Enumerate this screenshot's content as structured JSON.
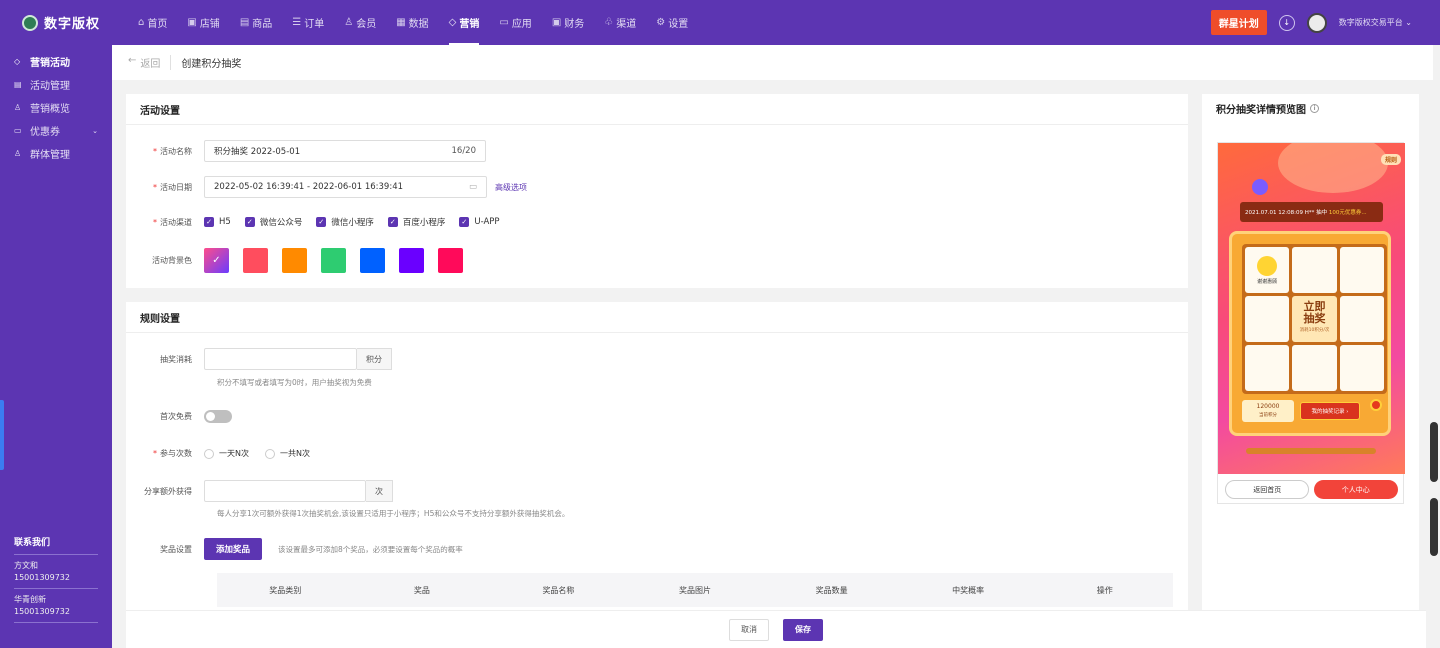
{
  "app": {
    "logo_text": "数字版权"
  },
  "nav": [
    {
      "label": "首页",
      "icon": "home-icon",
      "glyph": "⌂",
      "active": false
    },
    {
      "label": "店铺",
      "icon": "store-icon",
      "glyph": "▣",
      "active": false
    },
    {
      "label": "商品",
      "icon": "goods-icon",
      "glyph": "▤",
      "active": false
    },
    {
      "label": "订单",
      "icon": "order-icon",
      "glyph": "☰",
      "active": false
    },
    {
      "label": "会员",
      "icon": "member-icon",
      "glyph": "♙",
      "active": false
    },
    {
      "label": "数据",
      "icon": "data-icon",
      "glyph": "▦",
      "active": false
    },
    {
      "label": "营销",
      "icon": "tag-icon",
      "glyph": "◇",
      "active": true
    },
    {
      "label": "应用",
      "icon": "app-icon",
      "glyph": "▭",
      "active": false
    },
    {
      "label": "财务",
      "icon": "finance-icon",
      "glyph": "▣",
      "active": false
    },
    {
      "label": "渠道",
      "icon": "channel-icon",
      "glyph": "♧",
      "active": false
    },
    {
      "label": "设置",
      "icon": "settings-icon",
      "glyph": "⚙",
      "active": false
    }
  ],
  "topbar": {
    "plan_button": "群星计划",
    "account_name": "数字版权交易平台"
  },
  "sidebar": {
    "items": [
      {
        "label": "营销活动",
        "icon": "tag-icon",
        "glyph": "◇"
      },
      {
        "label": "活动管理",
        "icon": "list-icon",
        "glyph": "▤"
      },
      {
        "label": "营销概览",
        "icon": "overview-icon",
        "glyph": "♙"
      },
      {
        "label": "优惠券",
        "icon": "coupon-icon",
        "glyph": "▭"
      },
      {
        "label": "群体管理",
        "icon": "group-icon",
        "glyph": "♙"
      }
    ],
    "contact_title": "联系我们",
    "contacts": [
      {
        "name": "方文和",
        "phone": "15001309732"
      },
      {
        "name": "华青创新",
        "phone": "15001309732"
      }
    ]
  },
  "breadcrumb": {
    "back": "返回",
    "current": "创建积分抽奖"
  },
  "activity": {
    "section_title": "活动设置",
    "name_label": "活动名称",
    "name_value": "积分抽奖  2022-05-01",
    "name_count": "16/20",
    "date_label": "活动日期",
    "date_value": "2022-05-02 16:39:41 - 2022-06-01 16:39:41",
    "advanced_link": "高级选项",
    "channel_label": "活动渠道",
    "channels": [
      "H5",
      "微信公众号",
      "微信小程序",
      "百度小程序",
      "U-APP"
    ],
    "bg_label": "活动背景色",
    "bg_colors": [
      "#ff4d5e",
      "#ff8a00",
      "#2ecc71",
      "#0061ff",
      "#6a00ff",
      "#ff0a5a"
    ]
  },
  "rules": {
    "section_title": "规则设置",
    "cost_label": "抽奖消耗",
    "cost_unit": "积分",
    "cost_hint": "积分不填写或者填写为0时，用户抽奖视为免费",
    "first_free_label": "首次免费",
    "times_label": "参与次数",
    "times_options": [
      "一天N次",
      "一共N次"
    ],
    "share_label": "分享额外获得",
    "share_unit": "次",
    "share_hint": "每人分享1次可额外获得1次抽奖机会,该设置只适用于小程序；H5和公众号不支持分享额外获得抽奖机会。",
    "prize_label": "奖品设置",
    "add_prize_button": "添加奖品",
    "prize_hint": "该设置最多可添加8个奖品，必须要设置每个奖品的概率",
    "table_headers": [
      "奖品类别",
      "奖品",
      "奖品名称",
      "奖品图片",
      "奖品数量",
      "中奖概率",
      "操作"
    ]
  },
  "footer": {
    "cancel": "取消",
    "save": "保存"
  },
  "preview": {
    "title": "积分抽奖详情预览图",
    "rules_tag": "规则",
    "ticker_text": "2021.07.01  12:08:09  H** 抽中",
    "ticker_prize": "100元优惠券...",
    "cell_thanks": "谢谢惠顾",
    "center_line1": "立即",
    "center_line2": "抽奖",
    "center_sub": "消耗10积分/次",
    "points_value": "120000",
    "points_label": "当前积分",
    "record_button": "我的抽奖记录 ›",
    "back_home": "返回首页",
    "personal_center": "个人中心"
  }
}
